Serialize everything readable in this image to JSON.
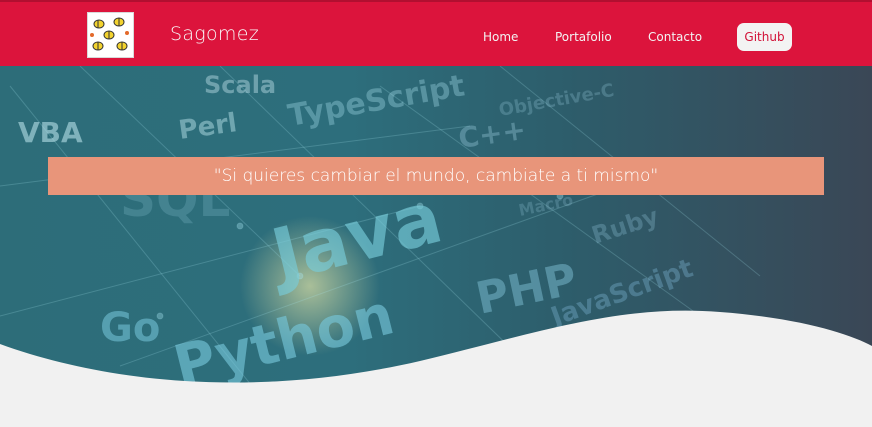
{
  "brand": {
    "name": "Sagomez"
  },
  "nav": {
    "home": "Home",
    "portfolio": "Portafolio",
    "contact": "Contacto",
    "github": "Github"
  },
  "hero": {
    "quote": "\"Si quieres cambiar el mundo, cambiate a ti mismo\"",
    "background_words": [
      "Scala",
      "VBA",
      "Perl",
      "TypeScript",
      "C++",
      "SQL",
      "Java",
      "PHP",
      "Ruby",
      "JavaScript",
      "Go",
      "Python",
      "Objective-C",
      "Macro"
    ]
  },
  "colors": {
    "navbar": "#dc143c",
    "quote_banner": "#e8957a",
    "page_background": "#f1f1f1",
    "github_text": "#d21137"
  }
}
